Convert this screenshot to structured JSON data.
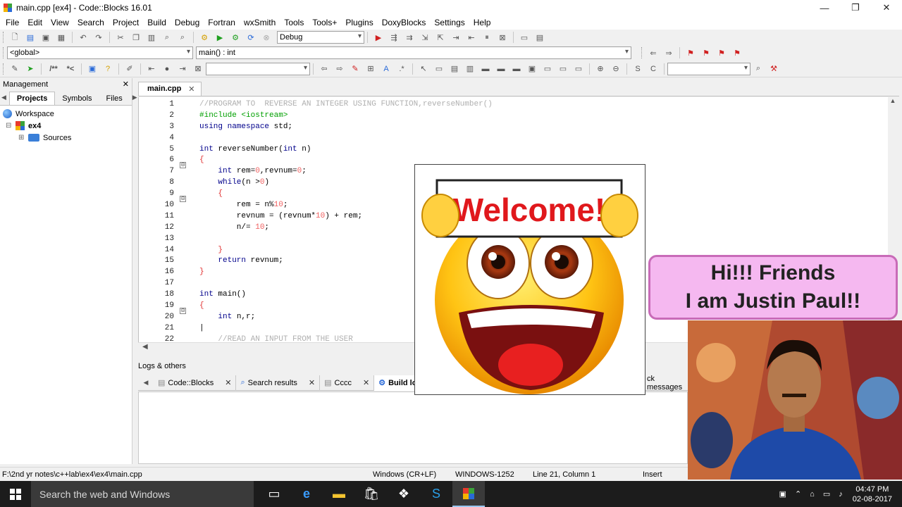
{
  "window": {
    "title": "main.cpp [ex4] - Code::Blocks 16.01",
    "controls": [
      "—",
      "❐",
      "✕"
    ]
  },
  "menu": [
    "File",
    "Edit",
    "View",
    "Search",
    "Project",
    "Build",
    "Debug",
    "Fortran",
    "wxSmith",
    "Tools",
    "Tools+",
    "Plugins",
    "DoxyBlocks",
    "Settings",
    "Help"
  ],
  "toolbar": {
    "build_target": "Debug",
    "scope": "<global>",
    "function": "main() : int",
    "search_combo": "",
    "find_combo": ""
  },
  "management": {
    "title": "Management",
    "close": "✕",
    "tabs": [
      "Projects",
      "Symbols",
      "Files"
    ],
    "tree": [
      {
        "label": "Workspace",
        "expander": ""
      },
      {
        "label": "ex4",
        "expander": "⊟"
      },
      {
        "label": "Sources",
        "expander": "⊞"
      }
    ]
  },
  "editor": {
    "tab": "main.cpp",
    "tab_close": "✕",
    "lines": [
      {
        "n": "1",
        "fold": "",
        "parts": [
          [
            "cm",
            "//PROGRAM TO  REVERSE AN INTEGER USING FUNCTION,reverseNumber()"
          ]
        ]
      },
      {
        "n": "2",
        "fold": "",
        "parts": [
          [
            "pp",
            "#include <iostream>"
          ]
        ]
      },
      {
        "n": "3",
        "fold": "",
        "parts": [
          [
            "k",
            "using namespace "
          ],
          [
            "",
            "std;"
          ]
        ]
      },
      {
        "n": "4",
        "fold": "",
        "parts": []
      },
      {
        "n": "5",
        "fold": "",
        "parts": [
          [
            "k",
            "int "
          ],
          [
            "",
            "reverseNumber("
          ],
          [
            "k",
            "int "
          ],
          [
            "",
            "n)"
          ]
        ]
      },
      {
        "n": "6",
        "fold": "⊟",
        "parts": [
          [
            "op",
            "{"
          ]
        ]
      },
      {
        "n": "7",
        "fold": "",
        "parts": [
          [
            "",
            "    "
          ],
          [
            "k",
            "int "
          ],
          [
            "",
            "rem="
          ],
          [
            "num",
            "0"
          ],
          [
            "",
            ",revnum="
          ],
          [
            "num",
            "0"
          ],
          [
            "",
            ";"
          ]
        ]
      },
      {
        "n": "8",
        "fold": "",
        "parts": [
          [
            "",
            "    "
          ],
          [
            "k",
            "while"
          ],
          [
            "",
            "(n >"
          ],
          [
            "num",
            "0"
          ],
          [
            "",
            ")"
          ]
        ]
      },
      {
        "n": "9",
        "fold": "⊟",
        "parts": [
          [
            "",
            "    "
          ],
          [
            "op",
            "{"
          ]
        ]
      },
      {
        "n": "10",
        "fold": "",
        "parts": [
          [
            "",
            "        rem = n%"
          ],
          [
            "num",
            "10"
          ],
          [
            "",
            ";"
          ]
        ]
      },
      {
        "n": "11",
        "fold": "",
        "parts": [
          [
            "",
            "        revnum = (revnum*"
          ],
          [
            "num",
            "10"
          ],
          [
            "",
            ") + rem;"
          ]
        ]
      },
      {
        "n": "12",
        "fold": "",
        "parts": [
          [
            "",
            "        n/= "
          ],
          [
            "num",
            "10"
          ],
          [
            "",
            ";"
          ]
        ]
      },
      {
        "n": "13",
        "fold": "",
        "parts": []
      },
      {
        "n": "14",
        "fold": "",
        "parts": [
          [
            "",
            "    "
          ],
          [
            "op",
            "}"
          ]
        ]
      },
      {
        "n": "15",
        "fold": "",
        "parts": [
          [
            "",
            "    "
          ],
          [
            "k",
            "return "
          ],
          [
            "",
            "revnum;"
          ]
        ]
      },
      {
        "n": "16",
        "fold": "",
        "parts": [
          [
            "op",
            "}"
          ]
        ]
      },
      {
        "n": "17",
        "fold": "",
        "parts": []
      },
      {
        "n": "18",
        "fold": "",
        "parts": [
          [
            "k",
            "int "
          ],
          [
            "",
            "main()"
          ]
        ]
      },
      {
        "n": "19",
        "fold": "⊟",
        "parts": [
          [
            "op",
            "{"
          ]
        ]
      },
      {
        "n": "20",
        "fold": "",
        "parts": [
          [
            "",
            "    "
          ],
          [
            "k",
            "int "
          ],
          [
            "",
            "n,r;"
          ]
        ]
      },
      {
        "n": "21",
        "fold": "",
        "parts": [
          [
            "",
            "|"
          ]
        ]
      },
      {
        "n": "22",
        "fold": "",
        "parts": [
          [
            "cm",
            "    //READ AN INPUT FROM THE USER"
          ]
        ]
      }
    ]
  },
  "logs": {
    "title": "Logs & others",
    "tabs": [
      {
        "label": "Code::Blocks",
        "close": "✕"
      },
      {
        "label": "Search results",
        "close": "✕"
      },
      {
        "label": "Cccc",
        "close": "✕"
      },
      {
        "label": "Build lo",
        "close": ""
      },
      {
        "label": "ck messages",
        "close": ""
      }
    ]
  },
  "status": {
    "path": "F:\\2nd yr notes\\c++lab\\ex4\\ex4\\main.cpp",
    "eol": "Windows (CR+LF)",
    "encoding": "WINDOWS-1252",
    "position": "Line 21, Column 1",
    "mode": "Insert"
  },
  "taskbar": {
    "search_placeholder": "Search the web and Windows",
    "time": "04:47 PM",
    "date": "02-08-2017"
  },
  "overlay": {
    "welcome_text": "Welcome!",
    "speech_line1": "Hi!!! Friends",
    "speech_line2": "I am Justin Paul!!"
  },
  "colors": {
    "accent": "#0078d7",
    "keyword": "#00008b",
    "comment": "#b0b0b0",
    "preprocessor": "#00a000",
    "number": "#f06060",
    "speech_bg": "#f5b8f0"
  }
}
